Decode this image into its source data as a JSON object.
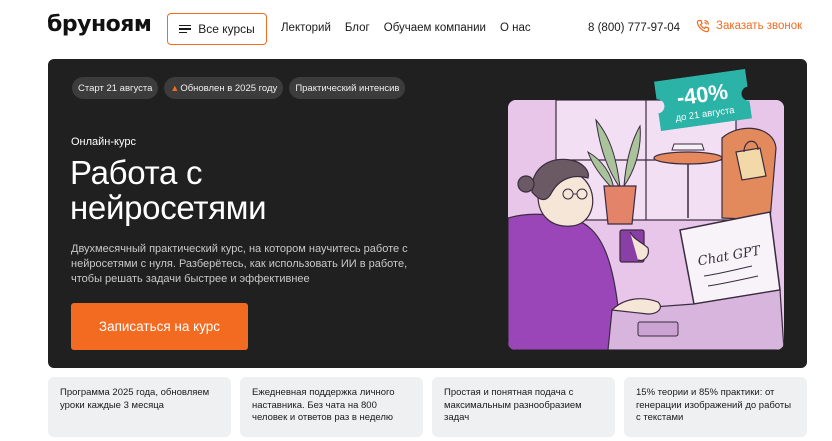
{
  "header": {
    "logo": "бруноям",
    "courses_button": "Все курсы",
    "nav": [
      "Лекторий",
      "Блог",
      "Обучаем компании",
      "О нас"
    ],
    "phone": "8 (800) 777-97-04",
    "callback": "Заказать звонок"
  },
  "hero": {
    "tags": [
      "Старт 21 августа",
      "Обновлен в 2025 году",
      "Практический интенсив"
    ],
    "kicker": "Онлайн-курс",
    "title": "Работа с нейросетями",
    "description": "Двухмесячный практический курс, на котором научитесь работе с нейросетями с нуля. Разберётесь, как использовать ИИ в работе, чтобы решать задачи быстрее и эффективнее",
    "cta": "Записаться на курс",
    "discount": {
      "value": "-40%",
      "note": "до 21 августа"
    },
    "illustration_text": "Chat GPT"
  },
  "features": [
    "Программа 2025 года, обновляем уроки каждые 3 месяца",
    "Ежедневная поддержка личного наставника. Без чата на 800 человек и ответов раз в неделю",
    "Простая и понятная подача с максимальным разнообразием задач",
    "15% теории и 85% практики: от генерации изображений до работы с текстами"
  ],
  "colors": {
    "accent": "#f26b21",
    "hero_bg": "#202020",
    "badge": "#2bb3a8",
    "feature_bg": "#eef0f1"
  },
  "icons": {
    "menu": "burger-menu-icon",
    "callback": "phone-icon",
    "tag": "fire-icon"
  }
}
